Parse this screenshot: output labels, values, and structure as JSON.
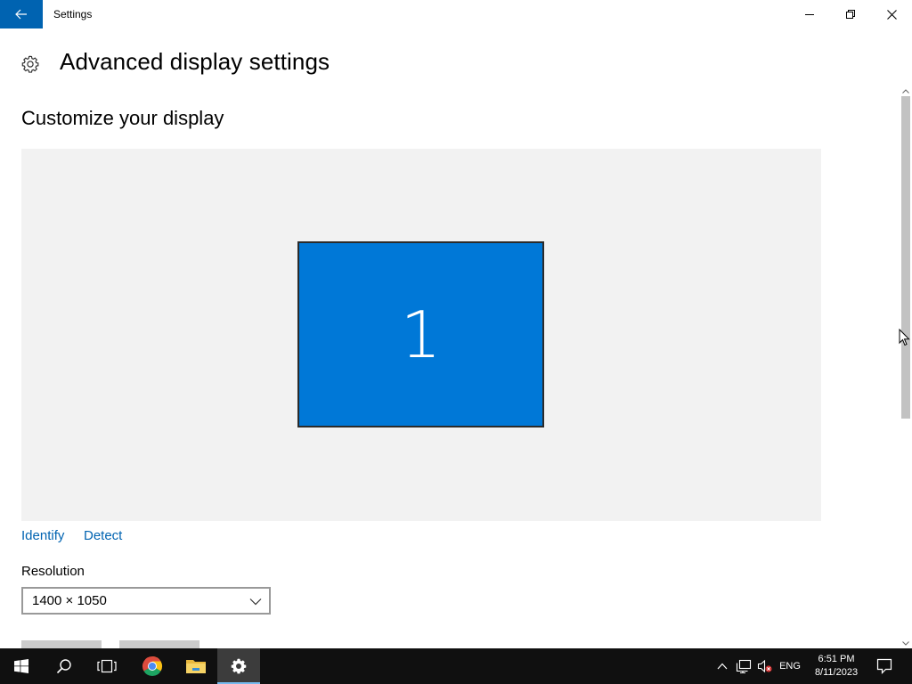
{
  "window": {
    "title": "Settings",
    "back_icon": "arrow-left-icon",
    "minimize_icon": "minimize-icon",
    "maximize_icon": "restore-icon",
    "close_icon": "close-icon"
  },
  "header": {
    "icon": "gear-icon",
    "title": "Advanced display settings"
  },
  "main": {
    "section_title": "Customize your display",
    "monitor": {
      "number": "1",
      "color": "#0078d7"
    },
    "links": {
      "identify": "Identify",
      "detect": "Detect"
    },
    "resolution": {
      "label": "Resolution",
      "value": "1400 × 1050"
    }
  },
  "taskbar": {
    "apps": [
      "windows-start-icon",
      "search-icon",
      "task-view-icon",
      "chrome-icon",
      "file-explorer-icon",
      "settings-gear-icon"
    ],
    "active_app": "settings-gear-icon",
    "tray": {
      "language": "ENG",
      "time": "6:51 PM",
      "date": "8/11/2023"
    }
  },
  "colors": {
    "accent": "#0063b1",
    "monitor": "#0078d7",
    "taskbar": "#101010",
    "display_area": "#f2f2f2"
  }
}
